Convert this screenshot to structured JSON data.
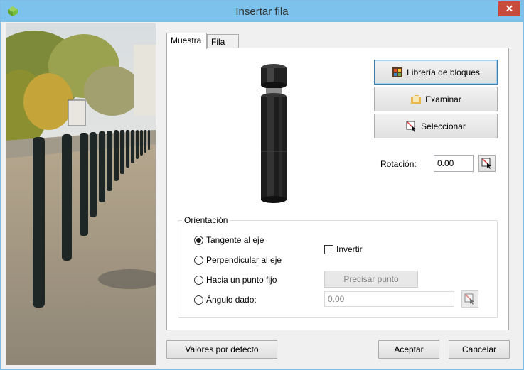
{
  "window": {
    "title": "Insertar fila",
    "close_glyph": "✕",
    "app_icon": "green-cube-icon",
    "accent_color": "#7cc2ec",
    "close_color": "#c74a3a"
  },
  "tabs": [
    {
      "label": "Muestra",
      "active": true
    },
    {
      "label": "Fila",
      "active": false
    }
  ],
  "sample": {
    "buttons": {
      "library": {
        "label": "Librería de bloques",
        "icon": "block-library-icon"
      },
      "browse": {
        "label": "Examinar",
        "icon": "folder-icon"
      },
      "select": {
        "label": "Seleccionar",
        "icon": "select-cursor-icon"
      }
    },
    "rotation": {
      "label": "Rotación:",
      "value": "0.00",
      "pick_icon": "pick-cursor-icon"
    },
    "orientation": {
      "title": "Orientación",
      "options": [
        {
          "label": "Tangente al eje",
          "checked": true
        },
        {
          "label": "Perpendicular al eje",
          "checked": false
        },
        {
          "label": "Hacia un punto fijo",
          "checked": false
        },
        {
          "label": "Ángulo dado:",
          "checked": false
        }
      ],
      "invert_label": "Invertir",
      "invert_checked": false,
      "point_button": "Precisar punto",
      "angle_value": "0.00"
    }
  },
  "footer": {
    "defaults": "Valores por defecto",
    "accept": "Aceptar",
    "cancel": "Cancelar"
  }
}
